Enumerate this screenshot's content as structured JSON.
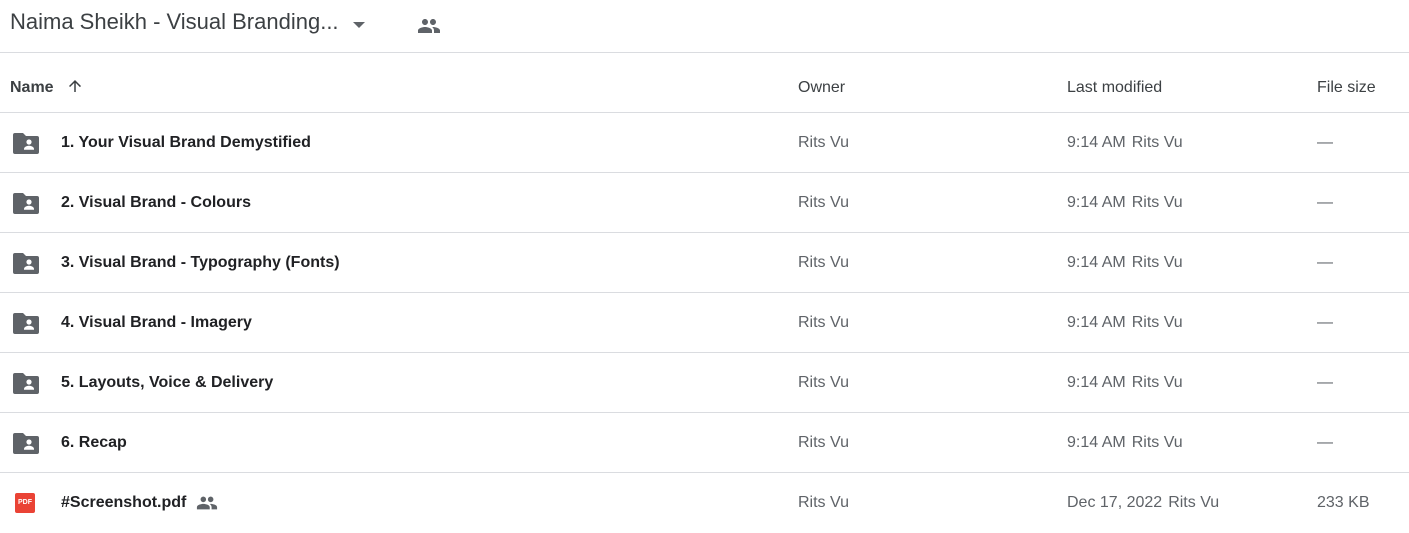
{
  "header": {
    "folder_title": "Naima Sheikh - Visual Branding...",
    "caret_icon": "arrow-drop-down-icon",
    "shared_icon": "people-icon"
  },
  "columns": {
    "name": "Name",
    "owner": "Owner",
    "last_modified": "Last modified",
    "file_size": "File size"
  },
  "sort": {
    "column": "name",
    "direction": "ascending",
    "icon": "arrow-up-icon"
  },
  "files": [
    {
      "name": "1. Your Visual Brand Demystified",
      "type": "shared-folder",
      "icon": "folder-shared-icon",
      "owner": "Rits Vu",
      "modified_time": "9:14 AM",
      "modified_by": "Rits Vu",
      "size": "—"
    },
    {
      "name": "2. Visual Brand - Colours",
      "type": "shared-folder",
      "icon": "folder-shared-icon",
      "owner": "Rits Vu",
      "modified_time": "9:14 AM",
      "modified_by": "Rits Vu",
      "size": "—"
    },
    {
      "name": "3. Visual Brand - Typography (Fonts)",
      "type": "shared-folder",
      "icon": "folder-shared-icon",
      "owner": "Rits Vu",
      "modified_time": "9:14 AM",
      "modified_by": "Rits Vu",
      "size": "—"
    },
    {
      "name": "4. Visual Brand - Imagery",
      "type": "shared-folder",
      "icon": "folder-shared-icon",
      "owner": "Rits Vu",
      "modified_time": "9:14 AM",
      "modified_by": "Rits Vu",
      "size": "—"
    },
    {
      "name": "5. Layouts, Voice & Delivery",
      "type": "shared-folder",
      "icon": "folder-shared-icon",
      "owner": "Rits Vu",
      "modified_time": "9:14 AM",
      "modified_by": "Rits Vu",
      "size": "—"
    },
    {
      "name": "6. Recap",
      "type": "shared-folder",
      "icon": "folder-shared-icon",
      "owner": "Rits Vu",
      "modified_time": "9:14 AM",
      "modified_by": "Rits Vu",
      "size": "—"
    },
    {
      "name": "#Screenshot.pdf",
      "type": "pdf",
      "icon": "pdf-icon",
      "badge": "PDF",
      "shared": true,
      "owner": "Rits Vu",
      "modified_time": "Dec 17, 2022",
      "modified_by": "Rits Vu",
      "size": "233 KB"
    }
  ],
  "colors": {
    "text": "#3c4043",
    "secondary_text": "#5f6368",
    "divider": "#dadce0",
    "folder_icon": "#5f6368",
    "pdf_red": "#ea4335"
  }
}
